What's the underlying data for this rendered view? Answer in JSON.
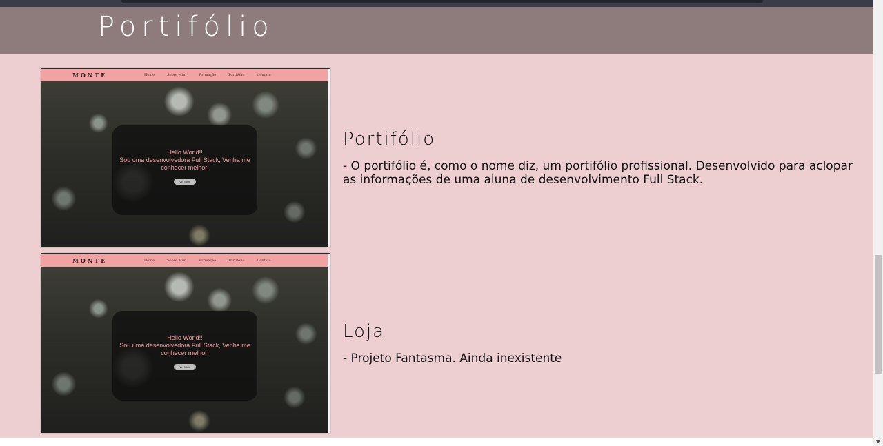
{
  "header": {
    "title": "Portifólio"
  },
  "thumbnail": {
    "brand": "MONTE",
    "nav": [
      "Home",
      "Sobre Mim",
      "Formação",
      "Portifólio",
      "Contato"
    ],
    "card_line1": "Hello World!!",
    "card_line2": "Sou uma desenvolvedora Full Stack, Venha me conhecer melhor!",
    "card_button": "Ver Mais"
  },
  "projects": [
    {
      "title": "Portifólio",
      "description": "- O portifólio é, como o nome diz, um portifólio profissional. Desenvolvido para aclopar as informações de uma aluna de desenvolvimento Full Stack."
    },
    {
      "title": "Loja",
      "description": "- Projeto Fantasma. Ainda inexistente"
    }
  ]
}
